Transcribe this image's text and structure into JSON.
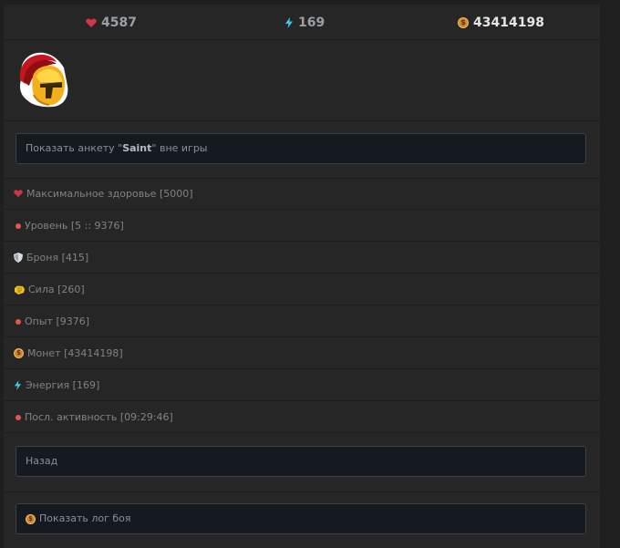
{
  "statsbar": {
    "hp": "4587",
    "energy": "169",
    "gold": "43414198",
    "icons": [
      "heart-icon",
      "bolt-icon",
      "coin-icon"
    ]
  },
  "avatar": {
    "icon": "spartan-helmet-icon"
  },
  "profile_button": {
    "prefix": "Показать анкету \"",
    "name": "Saint",
    "suffix": "\" вне игры"
  },
  "stats": [
    {
      "icon": "heart-icon",
      "label": "Максимальное здоровье [5000]"
    },
    {
      "icon": "red-dot-icon",
      "label": "Уровень [5 :: 9376]"
    },
    {
      "icon": "shield-icon",
      "label": "Броня [415]"
    },
    {
      "icon": "fist-icon",
      "label": "Сила [260]"
    },
    {
      "icon": "red-dot-icon",
      "label": "Опыт [9376]"
    },
    {
      "icon": "coin-icon",
      "label": "Монет [43414198]"
    },
    {
      "icon": "bolt-icon",
      "label": "Энергия [169]"
    },
    {
      "icon": "red-dot-icon",
      "label": "Посл. активность [09:29:46]"
    }
  ],
  "back_button": {
    "label": "Назад"
  },
  "battle_log_button": {
    "label": "Показать лог боя",
    "icon": "coin-icon"
  },
  "colors": {
    "background": "#1f1f20",
    "panel": "#262627",
    "button_bg": "#141a20",
    "button_border": "#3a4149",
    "hp_red": "#d3344a",
    "energy_cyan": "#3fc6e6",
    "gold": "#d48a2c",
    "dot_red": "#e4564a"
  }
}
